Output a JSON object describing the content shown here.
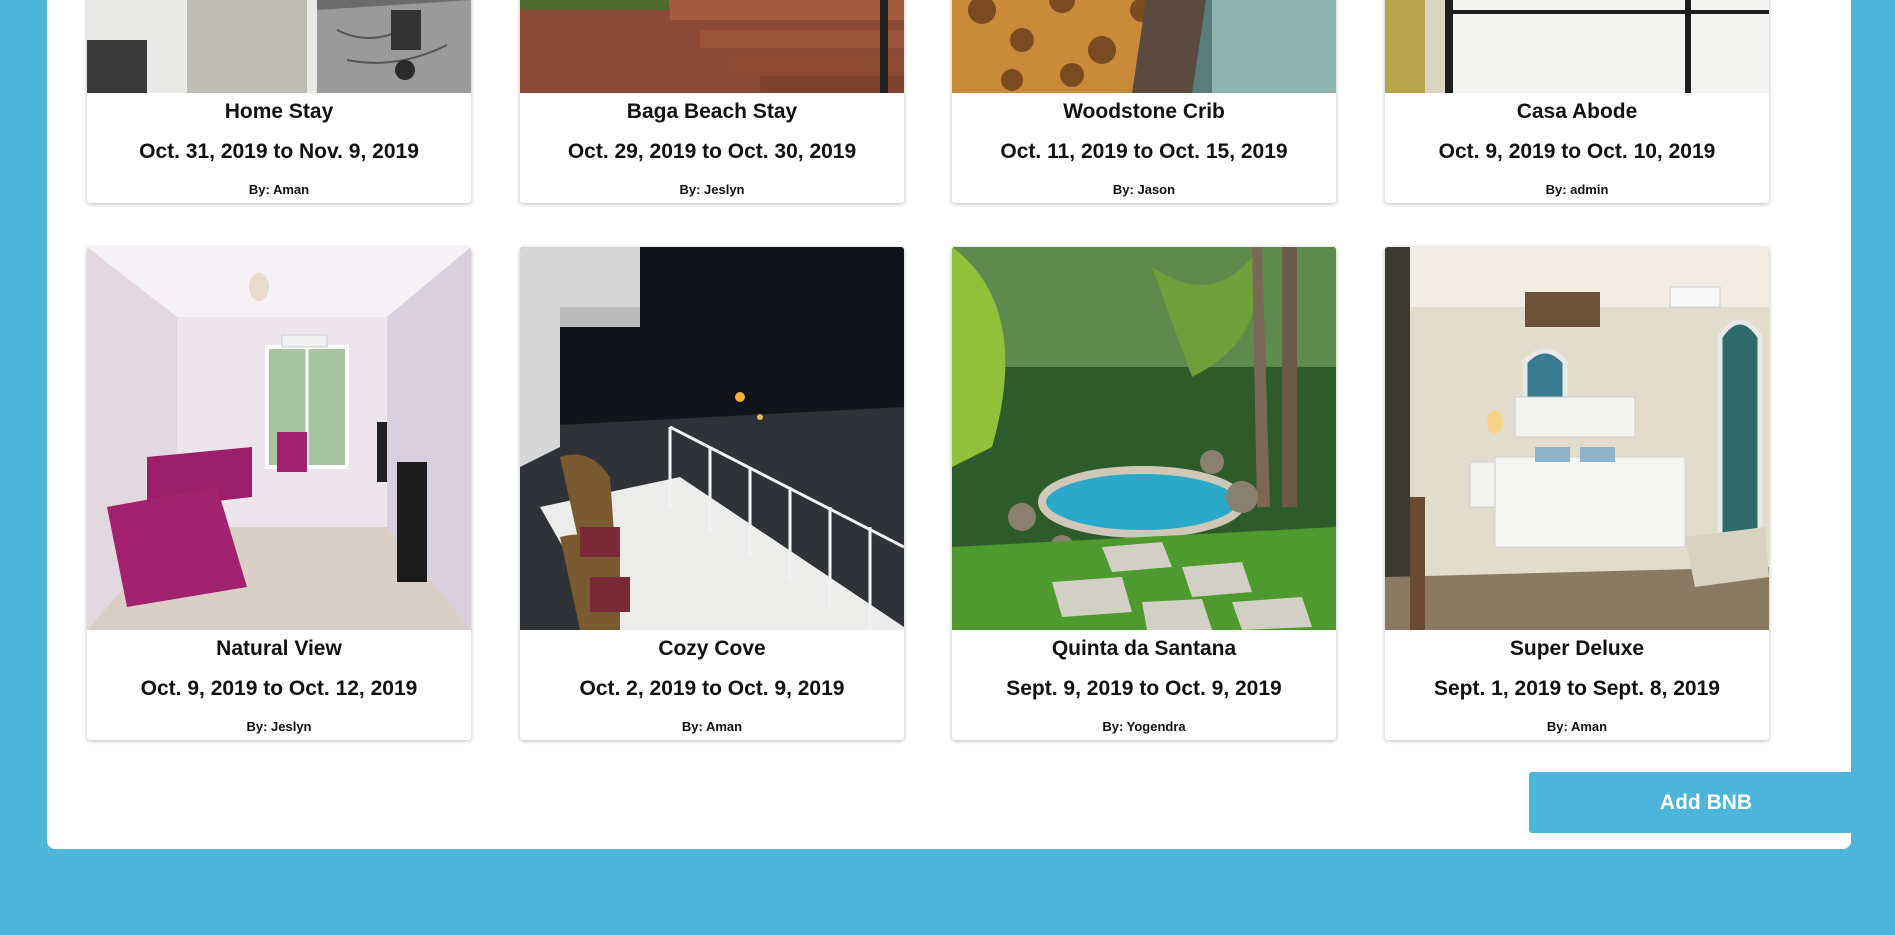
{
  "colors": {
    "background": "#4db5d9",
    "panel": "#ffffff",
    "button": "#4db5d9",
    "button_text": "#ffffff"
  },
  "listings": [
    {
      "title": "Home Stay",
      "dates": "Oct. 31, 2019 to Nov. 9, 2019",
      "by": "By: Aman",
      "image": "bedroom-desk-photo"
    },
    {
      "title": "Baga Beach Stay",
      "dates": "Oct. 29, 2019 to Oct. 30, 2019",
      "by": "By: Jeslyn",
      "image": "stairs-garden-photo"
    },
    {
      "title": "Woodstone Crib",
      "dates": "Oct. 11, 2019 to Oct. 15, 2019",
      "by": "By: Jason",
      "image": "stone-pool-photo"
    },
    {
      "title": "Casa Abode",
      "dates": "Oct. 9, 2019 to Oct. 10, 2019",
      "by": "By: admin",
      "image": "white-bed-photo"
    },
    {
      "title": "Natural View",
      "dates": "Oct. 9, 2019 to Oct. 12, 2019",
      "by": "By: Jeslyn",
      "image": "living-room-photo"
    },
    {
      "title": "Cozy Cove",
      "dates": "Oct. 2, 2019 to Oct. 9, 2019",
      "by": "By: Aman",
      "image": "night-balcony-photo"
    },
    {
      "title": "Quinta da Santana",
      "dates": "Sept. 9, 2019 to Oct. 9, 2019",
      "by": "By: Yogendra",
      "image": "garden-pool-photo"
    },
    {
      "title": "Super Deluxe",
      "dates": "Sept. 1, 2019 to Sept. 8, 2019",
      "by": "By: Aman",
      "image": "deluxe-bedroom-photo"
    }
  ],
  "add_button": {
    "label": "Add BNB"
  }
}
